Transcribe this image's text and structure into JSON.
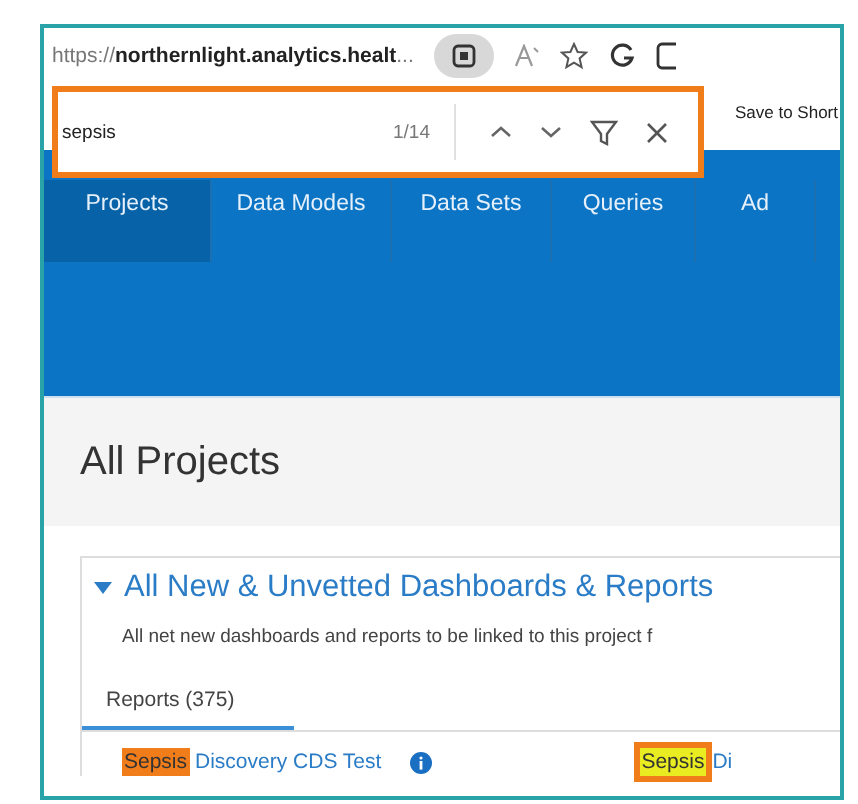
{
  "address_bar": {
    "url": "https://**northernlight.analytics.healt**..."
  },
  "find_bar": {
    "query": "sepsis",
    "match_count": "1/14"
  },
  "favorites_bar": {
    "item": "Save to Short"
  },
  "nav": {
    "tabs": [
      {
        "label": "Projects",
        "selected": true
      },
      {
        "label": "Data Models",
        "selected": false
      },
      {
        "label": "Data Sets",
        "selected": false
      },
      {
        "label": "Queries",
        "selected": false
      },
      {
        "label": "Ad",
        "selected": false
      }
    ]
  },
  "page": {
    "title": "All Projects",
    "section": {
      "title": "All New & Unvetted Dashboards & Reports",
      "expanded": true,
      "description": "All net new dashboards and reports to be linked to this project f",
      "tabs": [
        {
          "label": "Reports (375)",
          "selected": true
        }
      ],
      "rows": [
        {
          "highlight": "Sepsis",
          "link": "Discovery CDS Test",
          "highlight_2": "Sepsis",
          "link_2": "Di"
        }
      ]
    }
  }
}
